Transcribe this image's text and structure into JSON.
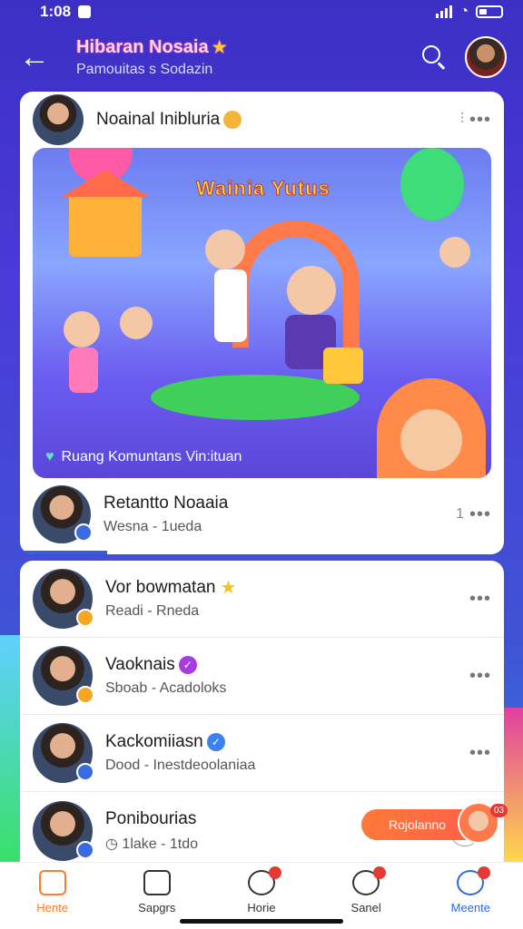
{
  "status_bar": {
    "time": "1:08"
  },
  "header": {
    "title": "Hibaran Nosaia",
    "subtitle": "Pamouitas s Sodazin"
  },
  "post": {
    "author": "Noainal Inibluria",
    "banner_title": "Wainia Yutus",
    "banner_caption": "Ruang Komuntans Vin:ituan",
    "footer_name": "Retantto Noaaia",
    "footer_meta": "Wesna - 1ueda"
  },
  "list": [
    {
      "name": "Vor bowmatan",
      "meta": "Readi - Rneda",
      "badge": "star",
      "status_color": "#f5a623"
    },
    {
      "name": "Vaoknais",
      "meta": "Sboab - Acadoloks",
      "badge": "purple",
      "status_color": "#f5a623"
    },
    {
      "name": "Kackomiiasn",
      "meta": "Dood - Inestdeoolaniaa",
      "badge": "blue",
      "status_color": "#3a6ae0"
    },
    {
      "name": "Ponibourias",
      "meta": "1lake - 1tdo",
      "badge": "",
      "status_color": "#3a6ae0"
    }
  ],
  "recommend": {
    "label": "Rojolanno",
    "count": "03"
  },
  "nav": [
    {
      "label": "Hente",
      "icon": "home-icon",
      "state": "active"
    },
    {
      "label": "Sapgrs",
      "icon": "pages-icon",
      "state": ""
    },
    {
      "label": "Horie",
      "icon": "target-icon",
      "state": ""
    },
    {
      "label": "Sanel",
      "icon": "community-icon",
      "state": ""
    },
    {
      "label": "Meente",
      "icon": "chat-icon",
      "state": "accent"
    }
  ],
  "colors": {
    "accent_orange": "#ff7a2a",
    "accent_blue": "#2a6ae0",
    "header_gradient_top": "#3b2fc4"
  }
}
